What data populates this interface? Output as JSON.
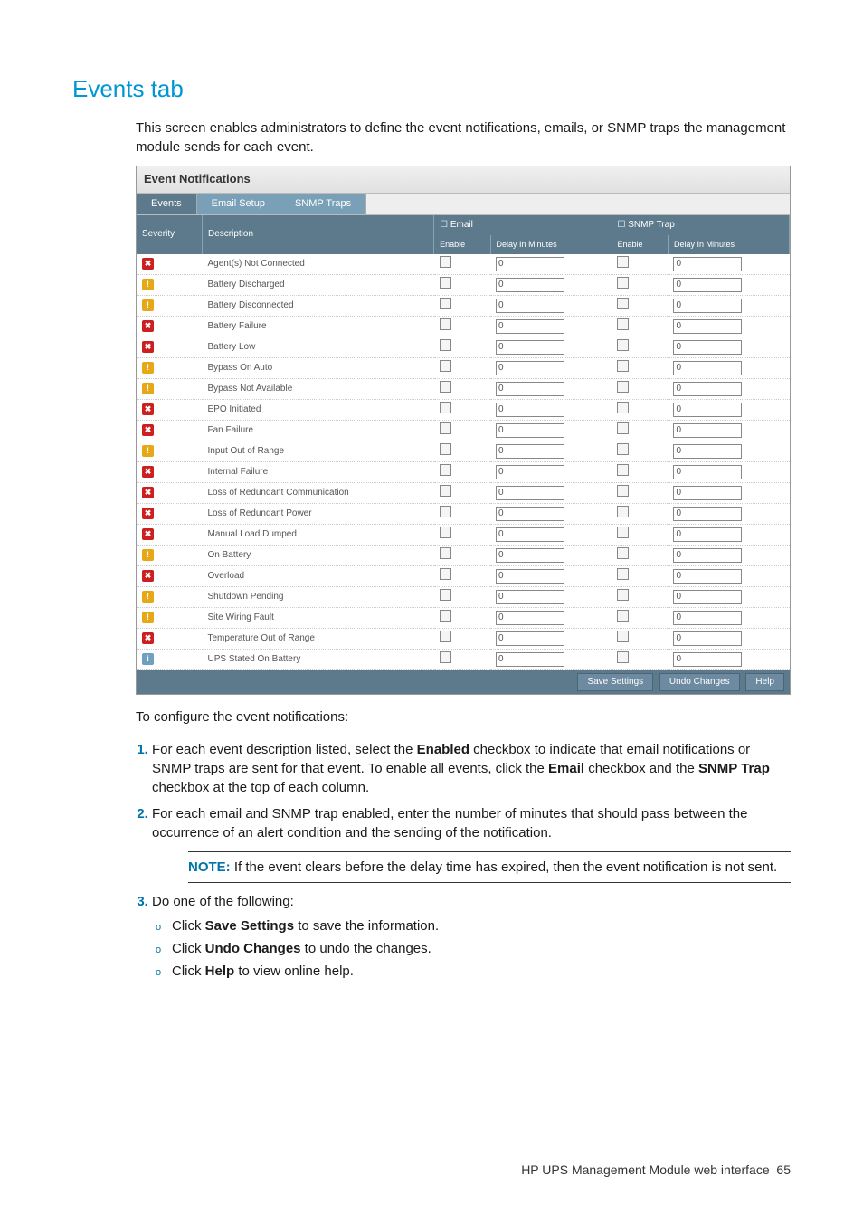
{
  "heading": "Events tab",
  "intro": "This screen enables administrators to define the event notifications, emails, or SNMP traps the management module sends for each event.",
  "scr": {
    "title": "Event Notifications",
    "tabs": {
      "t0": "Events",
      "t1": "Email Setup",
      "t2": "SNMP Traps"
    },
    "hdr": {
      "severity": "Severity",
      "description": "Description",
      "email": "Email",
      "snmp": "SNMP Trap",
      "enable": "Enable",
      "delay": "Delay In Minutes"
    },
    "rows": [
      {
        "sev": "crit",
        "glyph": "✖",
        "desc": "Agent(s) Not Connected",
        "d": "0"
      },
      {
        "sev": "warn",
        "glyph": "!",
        "desc": "Battery Discharged",
        "d": "0"
      },
      {
        "sev": "warn",
        "glyph": "!",
        "desc": "Battery Disconnected",
        "d": "0"
      },
      {
        "sev": "crit",
        "glyph": "✖",
        "desc": "Battery Failure",
        "d": "0"
      },
      {
        "sev": "crit",
        "glyph": "✖",
        "desc": "Battery Low",
        "d": "0"
      },
      {
        "sev": "warn",
        "glyph": "!",
        "desc": "Bypass On Auto",
        "d": "0"
      },
      {
        "sev": "warn",
        "glyph": "!",
        "desc": "Bypass Not Available",
        "d": "0"
      },
      {
        "sev": "crit",
        "glyph": "✖",
        "desc": "EPO Initiated",
        "d": "0"
      },
      {
        "sev": "crit",
        "glyph": "✖",
        "desc": "Fan Failure",
        "d": "0"
      },
      {
        "sev": "warn",
        "glyph": "!",
        "desc": "Input Out of Range",
        "d": "0"
      },
      {
        "sev": "crit",
        "glyph": "✖",
        "desc": "Internal Failure",
        "d": "0"
      },
      {
        "sev": "crit",
        "glyph": "✖",
        "desc": "Loss of Redundant Communication",
        "d": "0"
      },
      {
        "sev": "crit",
        "glyph": "✖",
        "desc": "Loss of Redundant Power",
        "d": "0"
      },
      {
        "sev": "crit",
        "glyph": "✖",
        "desc": "Manual Load Dumped",
        "d": "0"
      },
      {
        "sev": "warn",
        "glyph": "!",
        "desc": "On Battery",
        "d": "0"
      },
      {
        "sev": "crit",
        "glyph": "✖",
        "desc": "Overload",
        "d": "0"
      },
      {
        "sev": "warn",
        "glyph": "!",
        "desc": "Shutdown Pending",
        "d": "0"
      },
      {
        "sev": "warn",
        "glyph": "!",
        "desc": "Site Wiring Fault",
        "d": "0"
      },
      {
        "sev": "crit",
        "glyph": "✖",
        "desc": "Temperature Out of Range",
        "d": "0"
      },
      {
        "sev": "info",
        "glyph": "i",
        "desc": "UPS Stated On Battery",
        "d": "0"
      }
    ],
    "buttons": {
      "save": "Save Settings",
      "undo": "Undo Changes",
      "help": "Help"
    }
  },
  "config_lead": "To configure the event notifications:",
  "step1": {
    "a": "For each event description listed, select the ",
    "b": "Enabled",
    "c": " checkbox to indicate that email notifications or SNMP traps are sent for that event. To enable all events, click the ",
    "d": "Email",
    "e": " checkbox and the ",
    "f": "SNMP Trap",
    "g": " checkbox at the top of each column."
  },
  "step2": "For each email and SNMP trap enabled, enter the number of minutes that should pass between the occurrence of an alert condition and the sending of the notification.",
  "note": {
    "label": "NOTE:",
    "text": "  If the event clears before the delay time has expired, then the event notification is not sent."
  },
  "step3_lead": "Do one of the following:",
  "sub": {
    "s1a": "Click ",
    "s1b": "Save Settings",
    "s1c": " to save the information.",
    "s2a": "Click ",
    "s2b": "Undo Changes",
    "s2c": " to undo the changes.",
    "s3a": "Click ",
    "s3b": "Help",
    "s3c": " to view online help."
  },
  "footer": {
    "text": "HP UPS Management Module web interface",
    "page": "65"
  }
}
